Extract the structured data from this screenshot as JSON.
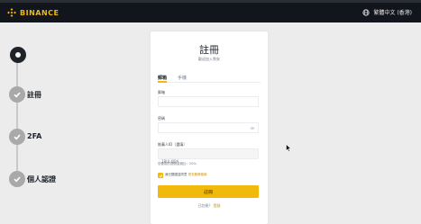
{
  "header": {
    "brand": "BINANCE",
    "language": "繁體中文 (香港)",
    "brand_color": "#f0b90b",
    "bg_color": "#12161c"
  },
  "steps": [
    {
      "label": "",
      "state": "active"
    },
    {
      "label": "註冊",
      "state": "done"
    },
    {
      "label": "2FA",
      "state": "done"
    },
    {
      "label": "個人認證",
      "state": "done"
    }
  ],
  "form": {
    "title": "註冊",
    "subtitle": "歡迎加入幣安",
    "tabs": [
      {
        "label": "郵箱",
        "active": true
      },
      {
        "label": "手機",
        "active": false
      }
    ],
    "email_label": "郵箱",
    "password_label": "密碼",
    "referral_label": "推薦人ID（選填）",
    "referral_placeholder": "1BUL6JRA",
    "referral_hint": "您使用的邀請返佣比：20%",
    "agree_text": "我已閱讀並同意 ",
    "agree_link": "幣安服務條款",
    "submit_label": "註冊",
    "login_prompt": "已註冊？",
    "login_link": "登錄"
  }
}
